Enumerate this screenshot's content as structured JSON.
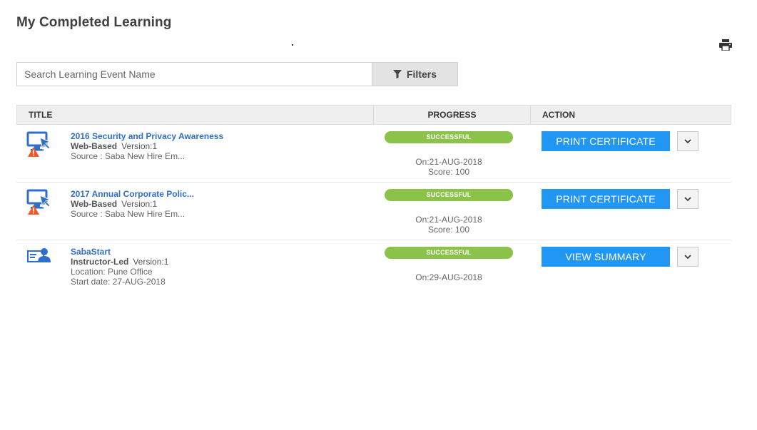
{
  "page": {
    "title": "My Completed Learning",
    "dot": "."
  },
  "search": {
    "placeholder": "Search Learning Event Name",
    "filters_label": "Filters"
  },
  "table": {
    "headers": {
      "title": "TITLE",
      "progress": "PROGRESS",
      "action": "ACTION"
    },
    "rows": [
      {
        "icon": "web-based-course-icon",
        "warning": true,
        "title": "2016 Security and Privacy Awareness",
        "type": "Web-Based",
        "version": "Version:1",
        "meta1": "Source : Saba New Hire Em...",
        "meta2": "",
        "status": "SUCCESSFUL",
        "date": "On:21-AUG-2018",
        "score": "Score: 100",
        "action": "PRINT CERTIFICATE"
      },
      {
        "icon": "web-based-course-icon",
        "warning": true,
        "title": "2017 Annual Corporate Polic...",
        "type": "Web-Based",
        "version": "Version:1",
        "meta1": "Source : Saba New Hire Em...",
        "meta2": "",
        "status": "SUCCESSFUL",
        "date": "On:21-AUG-2018",
        "score": "Score: 100",
        "action": "PRINT CERTIFICATE"
      },
      {
        "icon": "instructor-led-icon",
        "warning": false,
        "title": "SabaStart",
        "type": "Instructor-Led",
        "version": "Version:1",
        "meta1": "Location: Pune Office",
        "meta2": "Start date: 27-AUG-2018",
        "status": "SUCCESSFUL",
        "date": "On:29-AUG-2018",
        "score": "",
        "action": "VIEW SUMMARY"
      }
    ]
  },
  "colors": {
    "link": "#2f6fc9",
    "status": "#8bc34a",
    "primary_button": "#2196f3",
    "warning": "#f15a24"
  }
}
